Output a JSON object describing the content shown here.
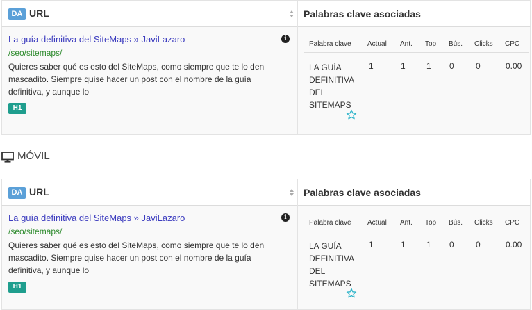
{
  "panels": [
    {
      "header": {
        "da_badge": "DA",
        "url_label": "URL",
        "keywords_label": "Palabras clave asociadas"
      },
      "result": {
        "title": "La guía definitiva del SiteMaps » JaviLazaro",
        "path": "/seo/sitemaps/",
        "description": "Quieres saber qué es esto del SiteMaps, como siempre que te lo den mascadito. Siempre quise hacer un post con el nombre de la guía definitiva, y aunque lo",
        "h1_badge": "H1",
        "info_glyph": "i"
      },
      "table": {
        "columns": [
          "Palabra clave",
          "Actual",
          "Ant.",
          "Top",
          "Bús.",
          "Clicks",
          "CPC"
        ],
        "row": {
          "keyword": "LA GUÍA DEFINITIVA DEL SITEMAPS",
          "actual": "1",
          "ant": "1",
          "top": "1",
          "bus": "0",
          "clicks": "0",
          "cpc": "0.00"
        }
      }
    },
    {
      "header": {
        "da_badge": "DA",
        "url_label": "URL",
        "keywords_label": "Palabras clave asociadas"
      },
      "result": {
        "title": "La guía definitiva del SiteMaps » JaviLazaro",
        "path": "/seo/sitemaps/",
        "description": "Quieres saber qué es esto del SiteMaps, como siempre que te lo den mascadito. Siempre quise hacer un post con el nombre de la guía definitiva, y aunque lo",
        "h1_badge": "H1",
        "info_glyph": "i"
      },
      "table": {
        "columns": [
          "Palabra clave",
          "Actual",
          "Ant.",
          "Top",
          "Bús.",
          "Clicks",
          "CPC"
        ],
        "row": {
          "keyword": "LA GUÍA DEFINITIVA DEL SITEMAPS",
          "actual": "1",
          "ant": "1",
          "top": "1",
          "bus": "0",
          "clicks": "0",
          "cpc": "0.00"
        }
      }
    }
  ],
  "section": {
    "label": "MÓVIL",
    "icon": "monitor-icon"
  },
  "colors": {
    "link": "#3d3dbf",
    "path": "#2e8b2e",
    "da_badge": "#5ba0d8",
    "h1_badge": "#1f9e8e",
    "star": "#2ab3c9"
  }
}
